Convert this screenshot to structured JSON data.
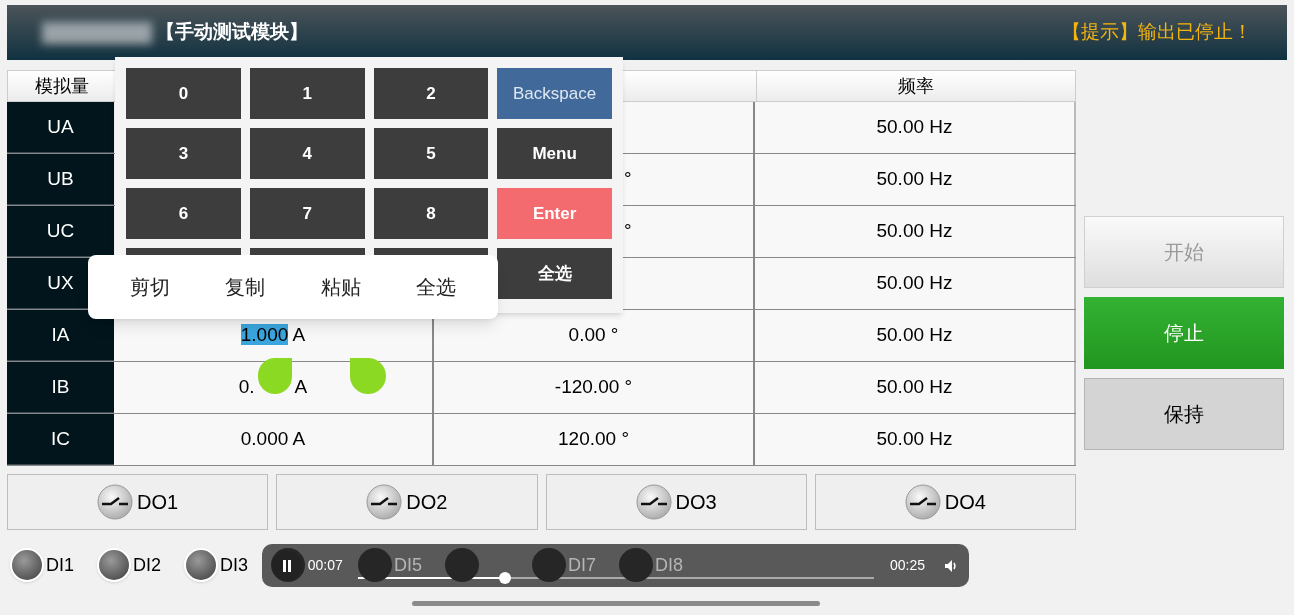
{
  "title_bar": {
    "title": "【手动测试模块】",
    "notice": "【提示】输出已停止！"
  },
  "table": {
    "column_1": "模拟量",
    "column_4": "频率",
    "rows": [
      {
        "name": "UA",
        "frequency": "50.00 Hz"
      },
      {
        "name": "UB",
        "phase": "°",
        "frequency": "50.00 Hz"
      },
      {
        "name": "UC",
        "phase": "°",
        "frequency": "50.00 Hz"
      },
      {
        "name": "UX",
        "frequency": "50.00 Hz"
      },
      {
        "name": "IA",
        "amplitude": [
          {
            "text": "1.000",
            "selected": true
          },
          {
            "text": " A",
            "selected": false
          }
        ],
        "phase": "0.00 °",
        "frequency": "50.00 Hz"
      },
      {
        "name": "IB",
        "amplitude": [
          {
            "text": "0.",
            "selected": false
          },
          {
            "text": "A",
            "selected": false
          }
        ],
        "phase": "-120.00 °",
        "frequency": "50.00 Hz"
      },
      {
        "name": "IC",
        "amplitude": [
          {
            "text": "0.000 A",
            "selected": false
          }
        ],
        "phase": "120.00 °",
        "frequency": "50.00 Hz"
      }
    ]
  },
  "keypad": {
    "keys": [
      {
        "label": "0",
        "kind": "digit"
      },
      {
        "label": "1",
        "kind": "digit"
      },
      {
        "label": "2",
        "kind": "digit"
      },
      {
        "label": "Backspace",
        "kind": "backspace"
      },
      {
        "label": "3",
        "kind": "digit"
      },
      {
        "label": "4",
        "kind": "digit"
      },
      {
        "label": "5",
        "kind": "digit"
      },
      {
        "label": "Menu",
        "kind": "menu"
      },
      {
        "label": "6",
        "kind": "digit"
      },
      {
        "label": "7",
        "kind": "digit"
      },
      {
        "label": "8",
        "kind": "digit"
      },
      {
        "label": "Enter",
        "kind": "enter"
      },
      {
        "kind": "digit"
      },
      {
        "kind": "digit"
      },
      {
        "kind": "digit"
      },
      {
        "label": "全选",
        "kind": "menu"
      }
    ]
  },
  "context_menu": [
    "剪切",
    "复制",
    "粘贴",
    "全选"
  ],
  "control_buttons": [
    {
      "label": "开始",
      "kind": "start",
      "disabled": true
    },
    {
      "label": "停止",
      "kind": "stop",
      "disabled": false
    },
    {
      "label": "保持",
      "kind": "hold",
      "disabled": false
    }
  ],
  "outputs": [
    "DO1",
    "DO2",
    "DO3",
    "DO4"
  ],
  "inputs": [
    {
      "label": "DI1",
      "on": false
    },
    {
      "label": "DI2",
      "on": false
    },
    {
      "label": "DI3",
      "on": false
    },
    {
      "on": false
    },
    {
      "label": "DI5",
      "on": false
    },
    {
      "on": false
    },
    {
      "label": "DI7",
      "on": false
    },
    {
      "label": "DI8",
      "on": false
    }
  ],
  "player": {
    "playing": true,
    "elapsed": "00:07",
    "level": 0.285,
    "total": "00:25"
  }
}
